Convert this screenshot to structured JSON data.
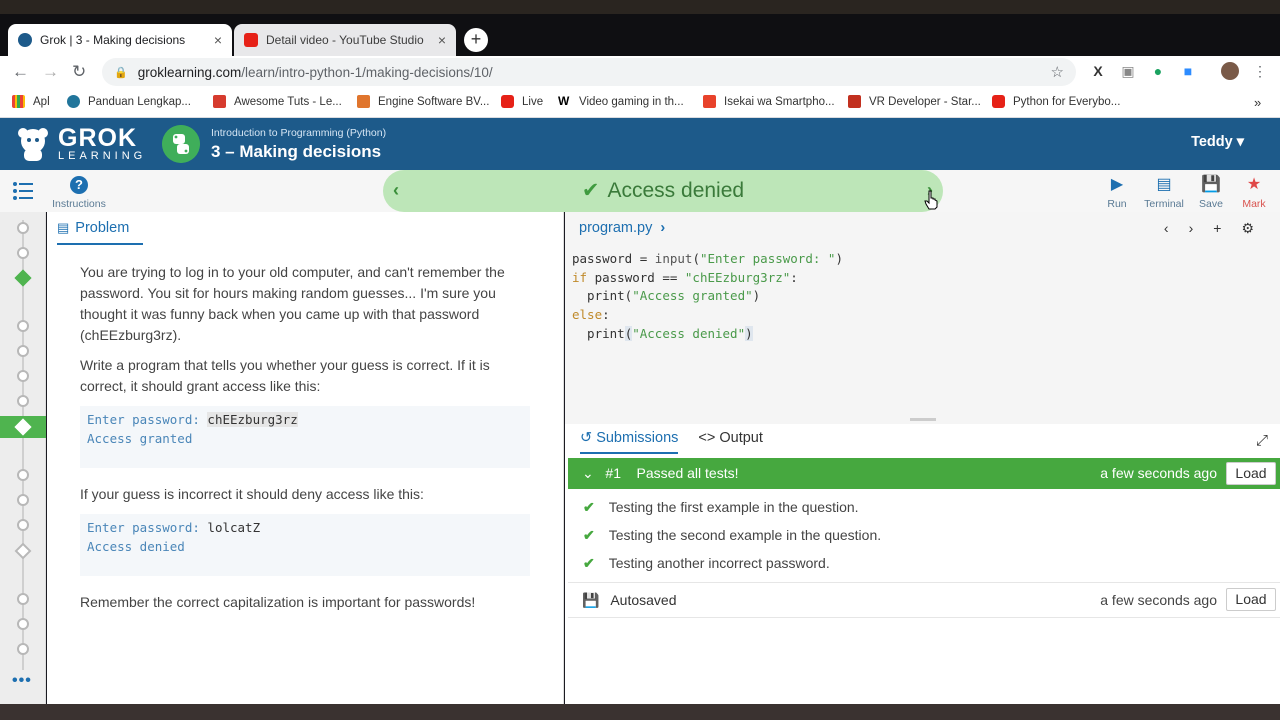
{
  "browser": {
    "tabs": [
      {
        "label": "Grok | 3 - Making decisions",
        "close": "×"
      },
      {
        "label": "Detail video - YouTube Studio",
        "close": "×"
      }
    ],
    "new_tab": "+",
    "url_host": "groklearning.com",
    "url_path": "/learn/intro-python-1/making-decisions/10/",
    "bookmarks": [
      {
        "label": "Apl"
      },
      {
        "label": "Panduan Lengkap..."
      },
      {
        "label": "Awesome Tuts - Le..."
      },
      {
        "label": "Engine Software BV..."
      },
      {
        "label": "Live"
      },
      {
        "label": "Video gaming in th..."
      },
      {
        "label": "Isekai wa Smartpho..."
      },
      {
        "label": "VR Developer - Star..."
      },
      {
        "label": "Python for Everybo..."
      }
    ],
    "bookmarks_more": "»"
  },
  "header": {
    "logo_line1": "GROK",
    "logo_line2": "LEARNING",
    "course_sub": "Introduction to Programming (Python)",
    "course_title": "3 – Making decisions",
    "user": "Teddy ▾"
  },
  "actionbar": {
    "instructions_label": "Instructions",
    "status_text": "Access denied",
    "run_label": "Run",
    "terminal_label": "Terminal",
    "save_label": "Save",
    "mark_label": "Mark"
  },
  "problem": {
    "tab_label": "Problem",
    "para1": "You are trying to log in to your old computer, and can't remember the password. You sit for hours making random guesses... I'm sure you thought it was funny back when you came up with that password (chEEzburg3rz).",
    "para2": "Write a program that tells you whether your guess is correct. If it is correct, it should grant access like this:",
    "ex1_prompt": "Enter password: ",
    "ex1_input": "chEEzburg3rz",
    "ex1_output": "Access granted",
    "para3": "If your guess is incorrect it should deny access like this:",
    "ex2_prompt": "Enter password: ",
    "ex2_input": "lolcatZ",
    "ex2_output": "Access denied",
    "para4": "Remember the correct capitalization is important for passwords!"
  },
  "editor": {
    "filename": "program.py",
    "code": {
      "l1a": "password = ",
      "l1b": "input",
      "l1c": "(",
      "l1d": "\"Enter password: \"",
      "l1e": ")",
      "l2a": "if",
      "l2b": " password == ",
      "l2c": "\"chEEzburg3rz\"",
      "l2d": ":",
      "l3a": "  print(",
      "l3b": "\"Access granted\"",
      "l3c": ")",
      "l4a": "else",
      "l4b": ":",
      "l5a": "  print",
      "l5b": "(",
      "l5c": "\"Access denied\"",
      "l5d": ")"
    }
  },
  "submissions": {
    "tab_submissions": "Submissions",
    "tab_output": "Output",
    "pass_number": "#1",
    "pass_text": "Passed all tests!",
    "pass_time": "a few seconds ago",
    "load_label": "Load",
    "tests": [
      "Testing the first example in the question.",
      "Testing the second example in the question.",
      "Testing another incorrect password."
    ],
    "autosaved_label": "Autosaved",
    "autosaved_time": "a few seconds ago"
  },
  "colors": {
    "header_bg": "#1d5a8a",
    "status_bg": "#bde6b8",
    "pass_green": "#46a83f",
    "link_blue": "#1d6fb0"
  }
}
